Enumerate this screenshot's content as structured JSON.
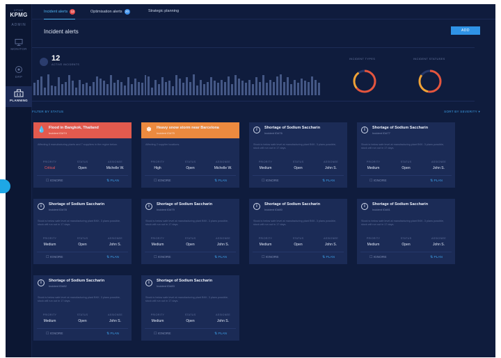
{
  "colors": {
    "background": "#0f1c3d",
    "accent": "#2f93e6",
    "critical": "#e25a4e",
    "high": "#ec8a3f"
  },
  "sidebar": {
    "logo_small": "KPMG",
    "logo": "KPMG",
    "role": "ADMIN",
    "items": [
      {
        "label": "MONITOR",
        "icon": "monitor-icon"
      },
      {
        "label": "DRP",
        "icon": "drp-icon"
      },
      {
        "label": "PLANNING",
        "icon": "planning-icon"
      }
    ]
  },
  "tabs": [
    {
      "label": "Incident alerts",
      "badge": "12"
    },
    {
      "label": "Optimisation alerts",
      "badge": "20"
    },
    {
      "label": "Strategic planning",
      "badge": ""
    }
  ],
  "page": {
    "title": "Incident alerts",
    "add_label": "ADD"
  },
  "summary": {
    "count": "12",
    "count_label": "ACTIVE INCIDENTS",
    "donut1_label": "INCIDENT TYPES",
    "donut2_label": "INCIDENT STATUSES",
    "bar_values": [
      0.55,
      0.7,
      0.85,
      0.35,
      0.95,
      0.45,
      0.4,
      0.8,
      0.5,
      0.6,
      0.9,
      0.65,
      0.35,
      0.7,
      0.5,
      0.55,
      0.4,
      0.6,
      0.85,
      0.75,
      0.65,
      0.5,
      0.9,
      0.55,
      0.7,
      0.6,
      0.45,
      0.8,
      0.5,
      0.75,
      0.6,
      0.55,
      0.9,
      0.85,
      0.35,
      0.7,
      0.5,
      0.8,
      0.6,
      0.65,
      0.4,
      0.9,
      0.75,
      0.55,
      0.8,
      0.6,
      0.95,
      0.45,
      0.7,
      0.5,
      0.6,
      0.8,
      0.65,
      0.55,
      0.7,
      0.6,
      0.85,
      0.5,
      0.9,
      0.75,
      0.65,
      0.55,
      0.7,
      0.5,
      0.8,
      0.6,
      0.9,
      0.55,
      0.7,
      0.6,
      0.85,
      0.95,
      0.6,
      0.8,
      0.5,
      0.7,
      0.55,
      0.75,
      0.65,
      0.6,
      0.85,
      0.7,
      0.55
    ]
  },
  "filter_label": "FILTER BY STATUS",
  "sort_label": "SORT BY SEVERITY",
  "meta_keys": {
    "priority": "PRIORITY",
    "status": "STATUS",
    "assignee": "ASSIGNEE"
  },
  "actions": {
    "ignore": "IGNORE",
    "plan": "PLAN"
  },
  "cards": [
    {
      "variant": "red",
      "title": "Flood in Bangkok, Thailand",
      "sub": "Incident ID#74",
      "desc": "Affecting 6 manufacturing plants and 7 suppliers in the region below.",
      "priority": "Critical",
      "status": "Open",
      "assignee": "Michelle W."
    },
    {
      "variant": "orange",
      "title": "Heavy snow storm near Barcelona",
      "sub": "Incident ID#75",
      "desc": "Affecting 2 supplier locations.",
      "priority": "High",
      "status": "Open",
      "assignee": "Michelle W."
    },
    {
      "variant": "plain",
      "title": "Shortage of Sodium Saccharin",
      "sub": "Incident ID#76",
      "desc": "Stock is below safe level at manufacturing plant BKK. 3 plans possible, stock will run out in 17 days.",
      "priority": "Medium",
      "status": "Open",
      "assignee": "John S."
    },
    {
      "variant": "plain",
      "title": "Shortage of Sodium Saccharin",
      "sub": "Incident ID#77",
      "desc": "Stock is below safe level at manufacturing plant BKK. 3 plans possible, stock will run out in 17 days.",
      "priority": "Medium",
      "status": "Open",
      "assignee": "John S."
    },
    {
      "variant": "plain",
      "title": "Shortage of Sodium Saccharin",
      "sub": "Incident ID#78",
      "desc": "Stock is below safe level at manufacturing plant BKK. 3 plans possible, stock will run out in 17 days.",
      "priority": "Medium",
      "status": "Open",
      "assignee": "John S."
    },
    {
      "variant": "plain",
      "title": "Shortage of Sodium Saccharin",
      "sub": "Incident ID#79",
      "desc": "Stock is below safe level at manufacturing plant BKK. 3 plans possible, stock will run out in 17 days.",
      "priority": "Medium",
      "status": "Open",
      "assignee": "John S."
    },
    {
      "variant": "plain",
      "title": "Shortage of Sodium Saccharin",
      "sub": "Incident ID#80",
      "desc": "Stock is below safe level at manufacturing plant BKK. 3 plans possible, stock will run out in 17 days.",
      "priority": "Medium",
      "status": "Open",
      "assignee": "John S."
    },
    {
      "variant": "plain",
      "title": "Shortage of Sodium Saccharin",
      "sub": "Incident ID#81",
      "desc": "Stock is below safe level at manufacturing plant BKK. 3 plans possible, stock will run out in 17 days.",
      "priority": "Medium",
      "status": "Open",
      "assignee": "John S."
    },
    {
      "variant": "plain",
      "title": "Shortage of Sodium Saccharin",
      "sub": "Incident ID#82",
      "desc": "Stock is below safe level at manufacturing plant BKK. 3 plans possible, stock will run out in 17 days.",
      "priority": "Medium",
      "status": "Open",
      "assignee": "John S."
    },
    {
      "variant": "plain",
      "title": "Shortage of Sodium Saccharin",
      "sub": "Incident ID#83",
      "desc": "Stock is below safe level at manufacturing plant BKK. 3 plans possible, stock will run out in 17 days.",
      "priority": "Medium",
      "status": "Open",
      "assignee": "John S."
    }
  ]
}
